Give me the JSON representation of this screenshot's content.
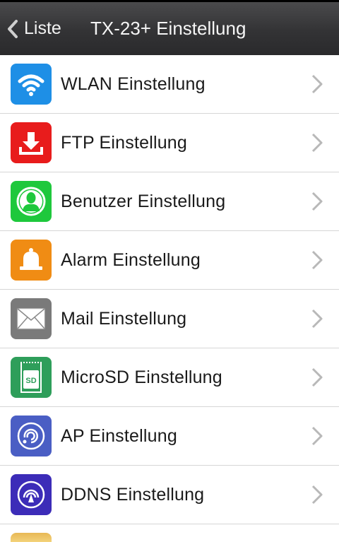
{
  "header": {
    "back_label": "Liste",
    "title": "TX-23+ Einstellung"
  },
  "settings": [
    {
      "label": "WLAN Einstellung",
      "icon": "wifi-icon",
      "color": "#1e8fe6"
    },
    {
      "label": "FTP Einstellung",
      "icon": "download-icon",
      "color": "#e81c1c"
    },
    {
      "label": "Benutzer Einstellung",
      "icon": "user-icon",
      "color": "#1ec83c"
    },
    {
      "label": "Alarm Einstellung",
      "icon": "bell-icon",
      "color": "#f08c14"
    },
    {
      "label": "Mail Einstellung",
      "icon": "envelope-icon",
      "color": "#7a7a7a"
    },
    {
      "label": "MicroSD Einstellung",
      "icon": "sd-card-icon",
      "color": "#2e9e5a"
    },
    {
      "label": "AP Einstellung",
      "icon": "access-point-icon",
      "color": "#4a5ec4"
    },
    {
      "label": "DDNS Einstellung",
      "icon": "ddns-icon",
      "color": "#3c2cb8"
    }
  ],
  "sd_icon_text": "SD"
}
